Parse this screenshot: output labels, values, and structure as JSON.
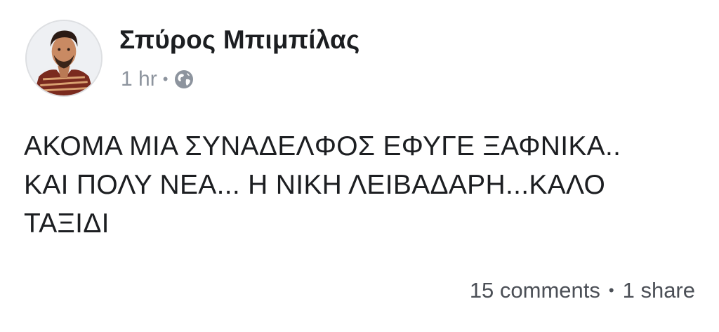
{
  "post": {
    "author_name": "Σπύρος Μπιμπίλας",
    "timestamp": "1 hr",
    "meta_separator": "•",
    "privacy_icon": "globe-icon",
    "text": "ΑΚΟΜΑ ΜΙΑ ΣΥΝΑΔΕΛΦΟΣ ΕΦΥΓΕ ΞΑΦΝΙΚΑ..\nΚΑΙ ΠΟΛΥ ΝΕΑ... Η ΝΙΚΗ ΛΕΙΒΑΔΑΡΗ...ΚΑΛΟ\nΤΑΞΙΔΙ",
    "comments_label": "15 comments",
    "footer_separator": "•",
    "shares_label": "1 share"
  },
  "colors": {
    "author": "#1c1e21",
    "meta": "#8d949e",
    "footer": "#4b4f56"
  }
}
